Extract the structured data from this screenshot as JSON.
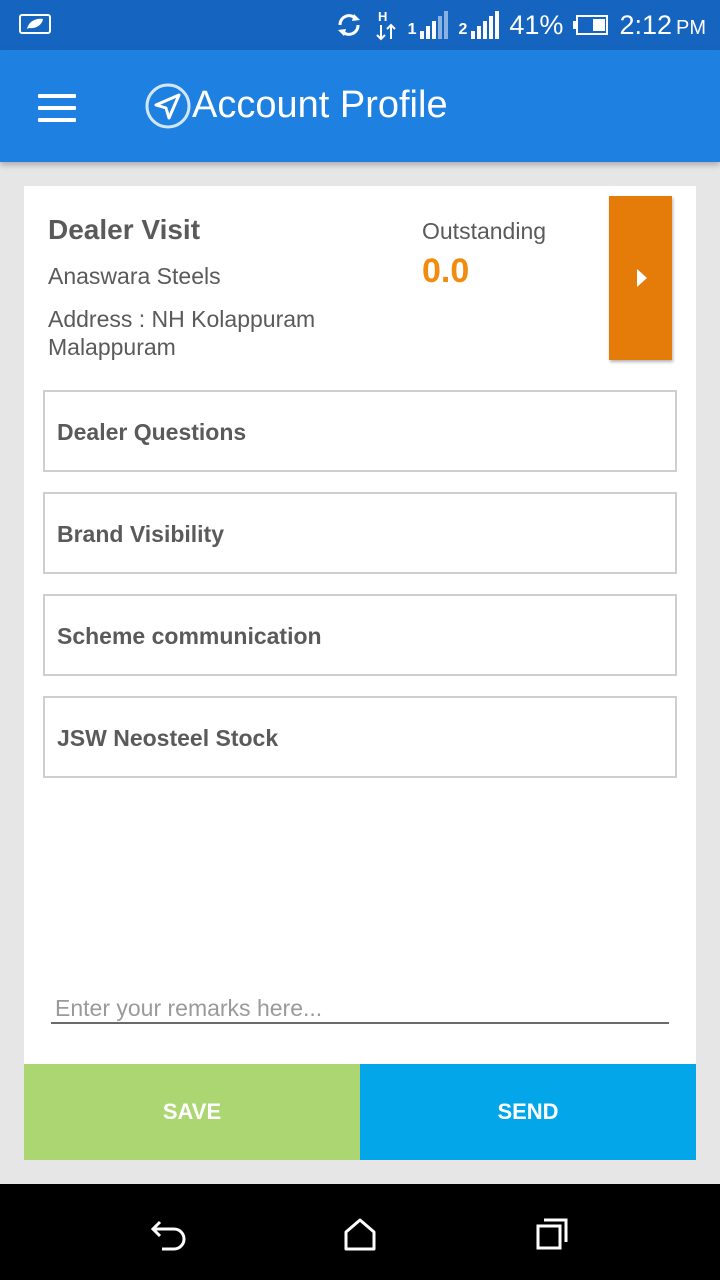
{
  "status_bar": {
    "signal1_label": "1",
    "signal2_label": "2",
    "network_label": "H",
    "battery_percent": "41%",
    "time": "2:12",
    "ampm": "PM"
  },
  "app_bar": {
    "title": "Account Profile"
  },
  "visit": {
    "title": "Dealer Visit",
    "dealer_name": "Anaswara Steels",
    "address": "Address : NH Kolappuram Malappuram",
    "outstanding_label": "Outstanding",
    "outstanding_value": "0.0"
  },
  "sections": [
    {
      "label": "Dealer Questions"
    },
    {
      "label": "Brand Visibility"
    },
    {
      "label": "Scheme communication"
    },
    {
      "label": "JSW Neosteel Stock"
    }
  ],
  "remarks": {
    "placeholder": "Enter your remarks here...",
    "value": ""
  },
  "actions": {
    "save_label": "SAVE",
    "send_label": "SEND"
  },
  "colors": {
    "status_bar": "#1565c0",
    "app_bar": "#1e80e0",
    "outstanding": "#f28c0f",
    "arrow_button": "#e57c0a",
    "save": "#acd672",
    "send": "#03a6e8"
  },
  "icons": {
    "status_left": "leaf-icon",
    "sync": "sync-icon",
    "data": "data-transfer-icon",
    "battery": "battery-icon",
    "menu": "menu-icon",
    "logo": "send-arrow-icon",
    "details": "chevron-right-icon",
    "nav_back": "back-icon",
    "nav_home": "home-icon",
    "nav_recents": "recents-icon"
  }
}
